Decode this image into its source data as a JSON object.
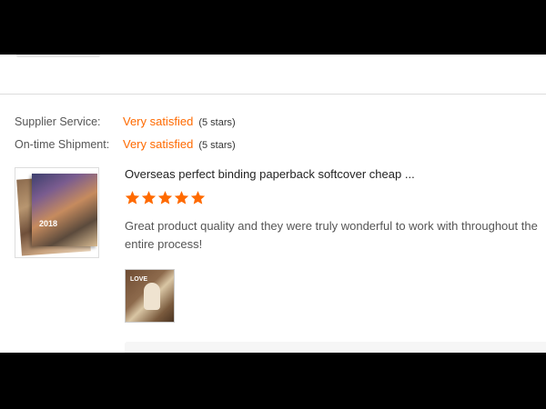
{
  "ratings": [
    {
      "label": "Supplier Service:",
      "value": "Very satisfied",
      "stars": "(5 stars)"
    },
    {
      "label": "On-time Shipment:",
      "value": "Very satisfied",
      "stars": "(5 stars)"
    }
  ],
  "review": {
    "product_title": "Overseas perfect binding paperback softcover cheap ...",
    "star_count": 5,
    "star_color": "#ff6a00",
    "text": "Great product quality and they were truly wonderful to work with throughout the entire process!",
    "thumbnail_year": "2018",
    "photo_caption": "LOVE"
  },
  "colors": {
    "accent": "#ff6a00",
    "text": "#555555",
    "divider": "#dcdcdc"
  }
}
